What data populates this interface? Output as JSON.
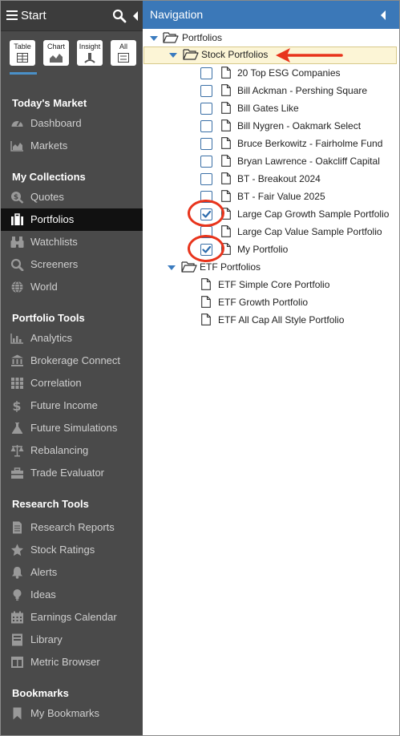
{
  "sidebar": {
    "start_label": "Start",
    "tiles": [
      {
        "label": "Table",
        "icon": "table-icon"
      },
      {
        "label": "Chart",
        "icon": "chart-icon"
      },
      {
        "label": "Insight",
        "icon": "insight-icon"
      },
      {
        "label": "All",
        "icon": "list-icon"
      }
    ],
    "sections": {
      "todays_market": {
        "title": "Today's Market",
        "items": [
          {
            "label": "Dashboard",
            "icon": "dashboard-icon"
          },
          {
            "label": "Markets",
            "icon": "markets-chart-icon"
          }
        ]
      },
      "my_collections": {
        "title": "My Collections",
        "items": [
          {
            "label": "Quotes",
            "icon": "quotes-icon"
          },
          {
            "label": "Portfolios",
            "icon": "briefcase-icon"
          },
          {
            "label": "Watchlists",
            "icon": "binoculars-icon"
          },
          {
            "label": "Screeners",
            "icon": "search-icon"
          },
          {
            "label": "World",
            "icon": "globe-icon"
          }
        ]
      },
      "portfolio_tools": {
        "title": "Portfolio Tools",
        "items": [
          {
            "label": "Analytics",
            "icon": "bar-chart-icon"
          },
          {
            "label": "Brokerage Connect",
            "icon": "bank-icon"
          },
          {
            "label": "Correlation",
            "icon": "grid-icon"
          },
          {
            "label": "Future Income",
            "icon": "dollar-icon"
          },
          {
            "label": "Future Simulations",
            "icon": "flask-icon"
          },
          {
            "label": "Rebalancing",
            "icon": "scale-icon"
          },
          {
            "label": "Trade Evaluator",
            "icon": "toolbox-icon"
          }
        ]
      },
      "research_tools": {
        "title": "Research Tools",
        "items": [
          {
            "label": "Research Reports",
            "icon": "document-icon"
          },
          {
            "label": "Stock Ratings",
            "icon": "star-icon"
          },
          {
            "label": "Alerts",
            "icon": "bell-icon"
          },
          {
            "label": "Ideas",
            "icon": "lightbulb-icon"
          },
          {
            "label": "Earnings Calendar",
            "icon": "calendar-icon"
          },
          {
            "label": "Library",
            "icon": "book-icon"
          },
          {
            "label": "Metric Browser",
            "icon": "columns-icon"
          }
        ]
      },
      "bookmarks": {
        "title": "Bookmarks",
        "items": [
          {
            "label": "My Bookmarks",
            "icon": "bookmark-icon"
          }
        ]
      }
    },
    "active_item": "Portfolios"
  },
  "navigation": {
    "title": "Navigation",
    "tree": {
      "root": {
        "label": "Portfolios"
      },
      "stock_folder": {
        "label": "Stock Portfolios",
        "selected": true,
        "items": [
          {
            "label": "20 Top ESG Companies",
            "checked": false
          },
          {
            "label": "Bill Ackman - Pershing Square",
            "checked": false
          },
          {
            "label": "Bill Gates Like",
            "checked": false
          },
          {
            "label": "Bill Nygren - Oakmark Select",
            "checked": false
          },
          {
            "label": "Bruce Berkowitz - Fairholme Fund",
            "checked": false
          },
          {
            "label": "Bryan Lawrence - Oakcliff Capital",
            "checked": false
          },
          {
            "label": "BT - Breakout 2024",
            "checked": false
          },
          {
            "label": "BT - Fair Value 2025",
            "checked": false
          },
          {
            "label": "Large Cap Growth Sample Portfolio",
            "checked": true
          },
          {
            "label": "Large Cap Value Sample Portfolio",
            "checked": false
          },
          {
            "label": "My Portfolio",
            "checked": true
          }
        ]
      },
      "etf_folder": {
        "label": "ETF Portfolios",
        "items": [
          {
            "label": "ETF Simple Core Portfolio"
          },
          {
            "label": "ETF Growth Portfolio"
          },
          {
            "label": "ETF All Cap All Style Portfolio"
          }
        ]
      }
    }
  },
  "colors": {
    "sidebar_bg": "#4a4a4a",
    "header_blue": "#3b78b8",
    "annotation_red": "#e8341c",
    "selected_row_bg": "#fcf5d6"
  }
}
